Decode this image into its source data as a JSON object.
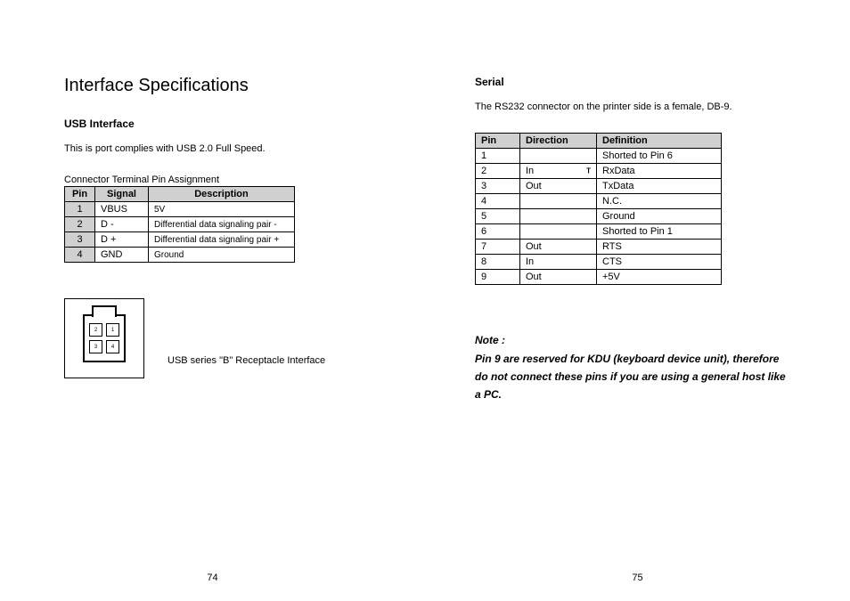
{
  "left": {
    "mainHeading": "Interface Specifications",
    "subHeading": "USB Interface",
    "bodyText": "This is port complies with USB 2.0 Full Speed.",
    "tableCaption": "Connector Terminal Pin Assignment",
    "usbTable": {
      "headers": [
        "Pin",
        "Signal",
        "Description"
      ],
      "rows": [
        {
          "pin": "1",
          "signal": "VBUS",
          "desc": "5V"
        },
        {
          "pin": "2",
          "signal": "D -",
          "desc": "Differential data signaling pair -"
        },
        {
          "pin": "3",
          "signal": "D +",
          "desc": "Differential data signaling pair +"
        },
        {
          "pin": "4",
          "signal": "GND",
          "desc": "Ground"
        }
      ]
    },
    "figurePins": {
      "tl": "2",
      "tr": "1",
      "bl": "3",
      "br": "4"
    },
    "figureCaption": "USB series \"B\" Receptacle Interface",
    "pageNumber": "74"
  },
  "right": {
    "subHeading": "Serial",
    "bodyText": "The RS232 connector on the printer side is a female, DB-9.",
    "serialTable": {
      "headers": [
        "Pin",
        "Direction",
        "Definition"
      ],
      "rows": [
        {
          "pin": "1",
          "dir": "",
          "def": "Shorted to Pin 6"
        },
        {
          "pin": "2",
          "dir": "In",
          "tmark": "T",
          "def": "RxData"
        },
        {
          "pin": "3",
          "dir": "Out",
          "def": "TxData"
        },
        {
          "pin": "4",
          "dir": "",
          "def": "N.C."
        },
        {
          "pin": "5",
          "dir": "",
          "def": "Ground"
        },
        {
          "pin": "6",
          "dir": "",
          "def": "Shorted to Pin 1"
        },
        {
          "pin": "7",
          "dir": "Out",
          "def": "RTS"
        },
        {
          "pin": "8",
          "dir": "In",
          "def": "CTS"
        },
        {
          "pin": "9",
          "dir": "Out",
          "def": "+5V"
        }
      ]
    },
    "noteLabel": "Note :",
    "noteBody": "Pin 9 are reserved for KDU (keyboard device unit), therefore do not connect these pins if you are using a general host like a PC.",
    "pageNumber": "75"
  }
}
